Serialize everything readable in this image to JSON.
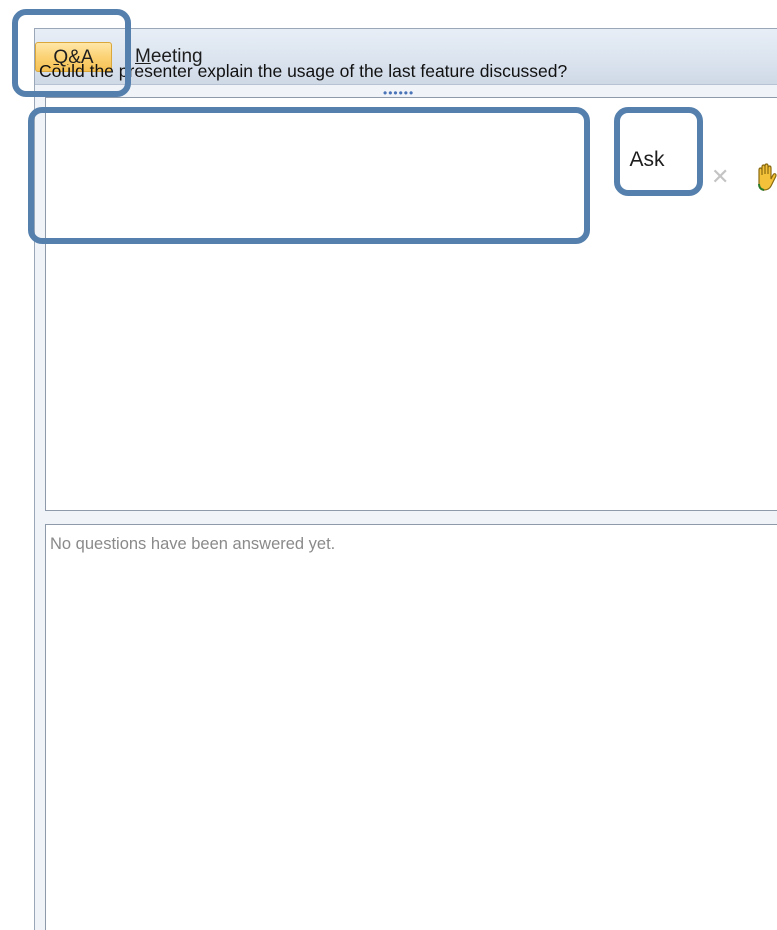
{
  "tabs": {
    "qa": {
      "prefix": "Q",
      "rest": "&A",
      "selected": true
    },
    "meeting": {
      "prefix": "M",
      "rest": "eeting",
      "selected": false
    }
  },
  "grip_glyph": "••••••",
  "question_input": {
    "value": "Could the presenter explain the usage of the last feature discussed?"
  },
  "ask_button": {
    "label": "Ask"
  },
  "cancel_icon": {
    "glyph": "✕",
    "name": "close-icon"
  },
  "raise_hand_icon": {
    "name": "raise-hand-icon"
  },
  "answered_pane": {
    "empty_message": "No questions have been answered yet."
  },
  "colors": {
    "accent": "#5580ad",
    "tab_selected": "#fbd274",
    "muted_text": "#8a8a8a"
  }
}
